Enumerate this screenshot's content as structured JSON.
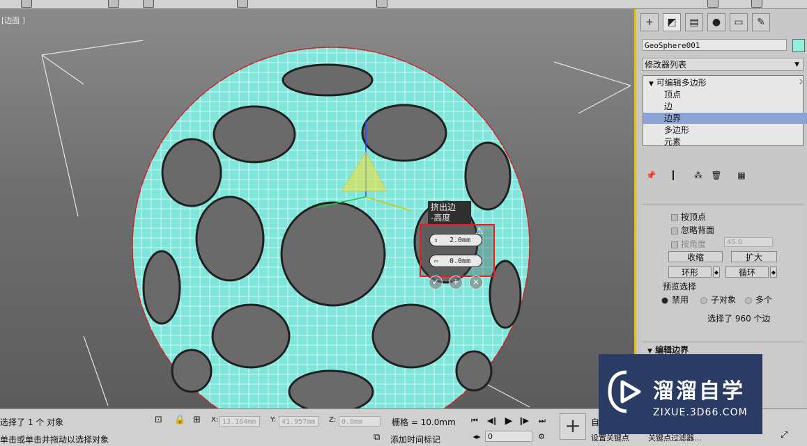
{
  "viewport": {
    "label": "[边面 ]",
    "caddy": {
      "title_line1": "挤出边",
      "title_line2": "-高度",
      "field1_value": "2.0mm",
      "field2_value": "0.0mm",
      "ok_icon": "check-icon",
      "apply_icon": "plus-icon",
      "cancel_icon": "close-icon"
    }
  },
  "command_panel": {
    "tabs": [
      "create-icon",
      "modify-icon",
      "hierarchy-icon",
      "motion-icon",
      "display-icon",
      "utilities-icon"
    ],
    "object_name": "GeoSphere001",
    "object_color": "#8ff0e0",
    "modifier_list_label": "修改器列表",
    "stack": {
      "root": "可编辑多边形",
      "items": [
        "顶点",
        "边",
        "边界",
        "多边形",
        "元素"
      ],
      "selected": "边界"
    },
    "selection": {
      "by_vertex": "按顶点",
      "ignore_backfacing": "忽略背面",
      "by_angle": "按角度",
      "angle_value": "45.0",
      "shrink": "收缩",
      "grow": "扩大",
      "ring": "环形",
      "loop": "循环",
      "preview_label": "预览选择",
      "preview_off": "禁用",
      "preview_subobject": "子对象",
      "preview_multi": "多个",
      "selection_count": "选择了 960 个边"
    },
    "edit_borders_title": "编辑边界"
  },
  "status_bar": {
    "selected_text": "选择了 1 个 对象",
    "prompt_text": "单击或单击并拖动以选择对象",
    "x_label": "X:",
    "x_value": "13.164mm",
    "y_label": "Y:",
    "y_value": "41.957mm",
    "z_label": "Z:",
    "z_value": "0.0mm",
    "grid_text": "栅格 = 10.0mm",
    "add_time_tag": "添加时间标记",
    "frame_value": "0",
    "set_key_label": "设置关键点",
    "key_filters_label": "关键点过滤器...",
    "auto_key_prefix": "自"
  },
  "watermark": {
    "name": "溜溜自学",
    "url": "ZIXUE.3D66.COM"
  }
}
